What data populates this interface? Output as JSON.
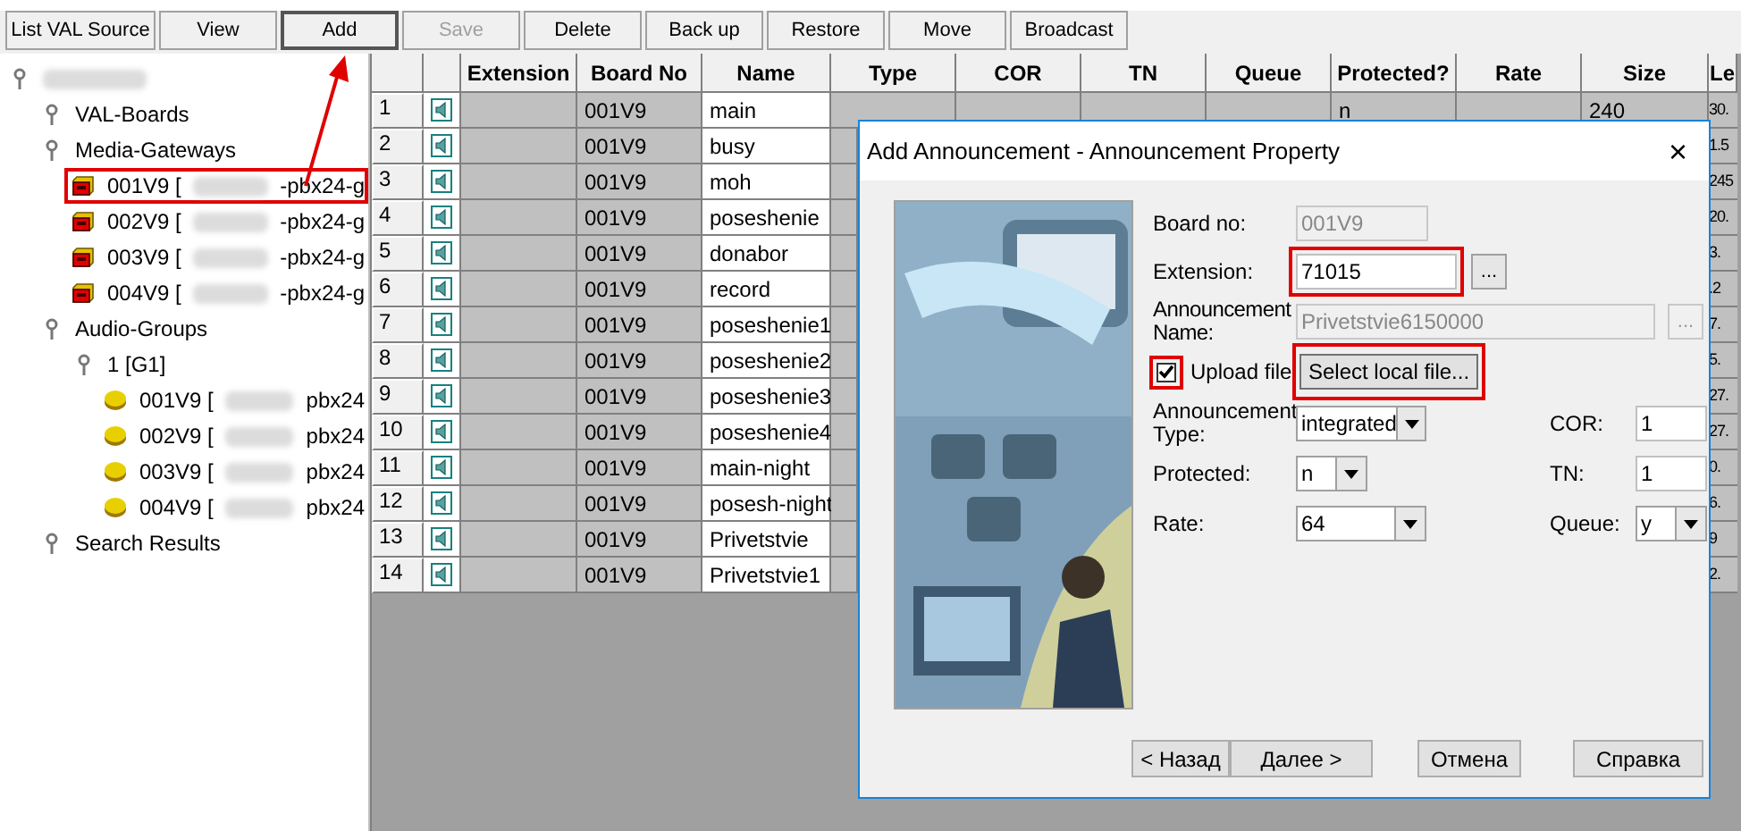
{
  "toolbar": [
    {
      "label": "List VAL Source",
      "disabled": false,
      "pressed": false,
      "arrow": false
    },
    {
      "label": "View",
      "disabled": false,
      "pressed": false,
      "arrow": false
    },
    {
      "label": "Add",
      "disabled": false,
      "pressed": true,
      "arrow": true
    },
    {
      "label": "Save",
      "disabled": true,
      "pressed": false,
      "arrow": false
    },
    {
      "label": "Delete",
      "disabled": false,
      "pressed": false,
      "arrow": false
    },
    {
      "label": "Back up",
      "disabled": false,
      "pressed": false,
      "arrow": false
    },
    {
      "label": "Restore",
      "disabled": false,
      "pressed": false,
      "arrow": false
    },
    {
      "label": "Move",
      "disabled": false,
      "pressed": false,
      "arrow": false
    },
    {
      "label": "Broadcast",
      "disabled": false,
      "pressed": false,
      "arrow": false
    }
  ],
  "tree": [
    {
      "kind": "folder",
      "redacted": true,
      "highlighted": false,
      "children": [
        {
          "kind": "folder",
          "label": "VAL-Boards",
          "redacted": false,
          "highlighted": false
        },
        {
          "kind": "folder",
          "label": "Media-Gateways",
          "redacted": false,
          "highlighted": false,
          "children": [
            {
              "kind": "gateway",
              "label": "001V9 [",
              "redacted": true,
              "suffix": "-pbx24-g",
              "highlighted": true
            },
            {
              "kind": "gateway",
              "label": "002V9 [",
              "redacted": true,
              "suffix": "-pbx24-g",
              "highlighted": false
            },
            {
              "kind": "gateway",
              "label": "003V9 [",
              "redacted": true,
              "suffix": "-pbx24-g",
              "highlighted": false
            },
            {
              "kind": "gateway",
              "label": "004V9 [",
              "redacted": true,
              "suffix": "-pbx24-g",
              "highlighted": false
            }
          ]
        },
        {
          "kind": "folder",
          "label": "Audio-Groups",
          "redacted": false,
          "highlighted": false,
          "children": [
            {
              "kind": "folder",
              "label": "1 [G1]",
              "redacted": false,
              "highlighted": false,
              "children": [
                {
                  "kind": "audio",
                  "label": "001V9 [",
                  "redacted": true,
                  "suffix": "pbx24",
                  "highlighted": false
                },
                {
                  "kind": "audio",
                  "label": "002V9 [",
                  "redacted": true,
                  "suffix": "pbx24",
                  "highlighted": false
                },
                {
                  "kind": "audio",
                  "label": "003V9 [",
                  "redacted": true,
                  "suffix": "pbx24",
                  "highlighted": false
                },
                {
                  "kind": "audio",
                  "label": "004V9 [",
                  "redacted": true,
                  "suffix": "pbx24",
                  "highlighted": false
                }
              ]
            }
          ]
        },
        {
          "kind": "folder",
          "label": "Search Results",
          "redacted": false,
          "highlighted": false
        }
      ]
    }
  ],
  "table": {
    "columns": [
      "Extension",
      "Board No",
      "Name",
      "Type",
      "COR",
      "TN",
      "Queue",
      "Protected?",
      "Rate",
      "Size",
      "Le"
    ],
    "rows": [
      {
        "num": "1",
        "board_no": "001V9",
        "name": "main",
        "protected": "n",
        "size": "240",
        "le": "30."
      },
      {
        "num": "2",
        "board_no": "001V9",
        "name": "busy",
        "le": "1.5"
      },
      {
        "num": "3",
        "board_no": "001V9",
        "name": "moh",
        "le": "245"
      },
      {
        "num": "4",
        "board_no": "001V9",
        "name": "poseshenie",
        "le": "20."
      },
      {
        "num": "5",
        "board_no": "001V9",
        "name": "donabor",
        "le": "3."
      },
      {
        "num": "6",
        "board_no": "001V9",
        "name": "record",
        "le": ".2"
      },
      {
        "num": "7",
        "board_no": "001V9",
        "name": "poseshenie1",
        "le": "7."
      },
      {
        "num": "8",
        "board_no": "001V9",
        "name": "poseshenie2",
        "le": "5."
      },
      {
        "num": "9",
        "board_no": "001V9",
        "name": "poseshenie3",
        "le": "27."
      },
      {
        "num": "10",
        "board_no": "001V9",
        "name": "poseshenie4",
        "le": "27."
      },
      {
        "num": "11",
        "board_no": "001V9",
        "name": "main-night",
        "le": "0."
      },
      {
        "num": "12",
        "board_no": "001V9",
        "name": "posesh-night",
        "le": "6."
      },
      {
        "num": "13",
        "board_no": "001V9",
        "name": "Privetstvie",
        "le": "9"
      },
      {
        "num": "14",
        "board_no": "001V9",
        "name": "Privetstvie1",
        "le": "2."
      }
    ]
  },
  "dialog": {
    "title": "Add Announcement - Announcement Property",
    "close": "×",
    "board_no": {
      "label": "Board no:",
      "value": "001V9",
      "disabled": true
    },
    "extension": {
      "label": "Extension:",
      "value": "71015",
      "button": "...",
      "highlighted": true
    },
    "announcement_name": {
      "label": "Announcement Name:",
      "value": "Privetstvie6150000",
      "button": "...",
      "disabled": true
    },
    "upload_file": {
      "label": "Upload file",
      "checked": true,
      "highlighted": true
    },
    "select_file": {
      "label": "Select local file...",
      "highlighted": true
    },
    "announcement_type": {
      "label": "Announcement Type:",
      "value": "integrated"
    },
    "protected": {
      "label": "Protected:",
      "value": "n"
    },
    "rate": {
      "label": "Rate:",
      "value": "64"
    },
    "cor": {
      "label": "COR:",
      "value": "1"
    },
    "tn": {
      "label": "TN:",
      "value": "1"
    },
    "queue": {
      "label": "Queue:",
      "value": "y"
    },
    "buttons": [
      "< Назад",
      "Далее >",
      "Отмена",
      "Справка"
    ]
  }
}
